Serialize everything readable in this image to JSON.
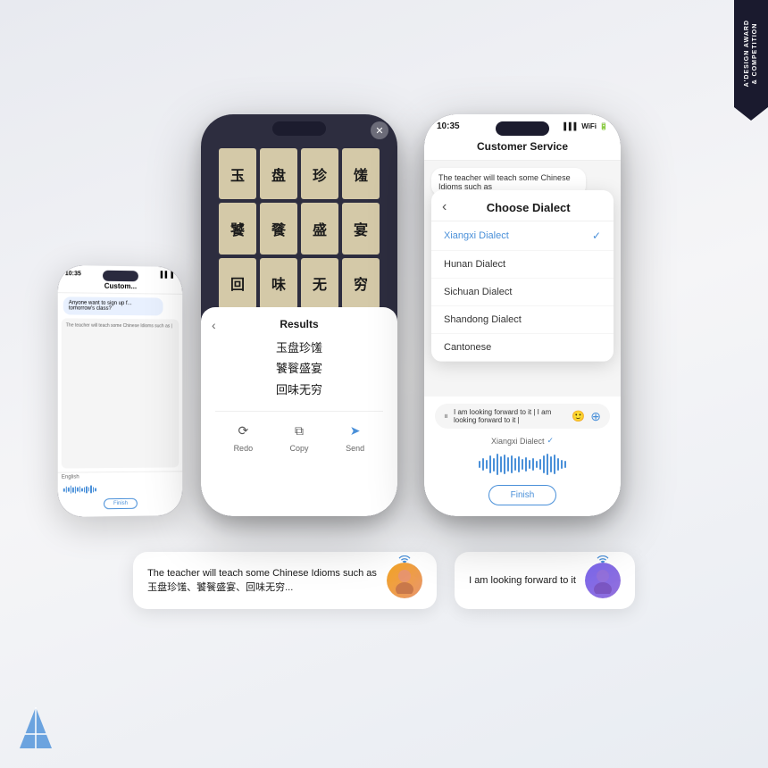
{
  "award": {
    "line1": "A'DESIGN AWARD",
    "line2": "& COMPETITION"
  },
  "left_phone_bg": {
    "time": "10:35",
    "section": "Custom...",
    "bubble_text": "Anyone want to sign up f... tomorrow's class?",
    "input_placeholder": "The teacher will teach some Chinese Idioms such as |",
    "language": "English",
    "finish_btn": "Finish"
  },
  "left_phone_main": {
    "ocr_characters": [
      "玉",
      "盘",
      "珍",
      "馐",
      "饕",
      "餮",
      "盛",
      "宴",
      "回",
      "味",
      "无",
      "穷"
    ],
    "results_title": "Results",
    "results_text_lines": [
      "玉盘珍馐",
      "饕餮盛宴",
      "回味无穷"
    ],
    "action_redo": "Redo",
    "action_copy": "Copy",
    "action_send": "Send"
  },
  "right_phone_main": {
    "time": "10:35",
    "header_title": "Customer Service",
    "bubble_text": "The teacher will teach some Chinese Idioms such as",
    "dialect_title": "Choose Dialect",
    "dialects": [
      {
        "name": "Xiangxi Dialect",
        "selected": true
      },
      {
        "name": "Hunan Dialect",
        "selected": false
      },
      {
        "name": "Sichuan Dialect",
        "selected": false
      },
      {
        "name": "Shandong Dialect",
        "selected": false
      },
      {
        "name": "Cantonese",
        "selected": false
      }
    ],
    "input_text": "I am looking forward to it | I am looking forward to it |",
    "dialect_label": "Xiangxi Dialect",
    "finish_btn": "Finish"
  },
  "captions": {
    "left_text": "The teacher will teach some Chinese Idioms such as 玉盘珍馐、饕餮盛宴、回味无穷...",
    "right_text": "I am looking forward to it"
  },
  "colors": {
    "accent_blue": "#4a90d9",
    "phone_dark": "#1c1c2e",
    "bg_light": "#f0f2f5"
  }
}
